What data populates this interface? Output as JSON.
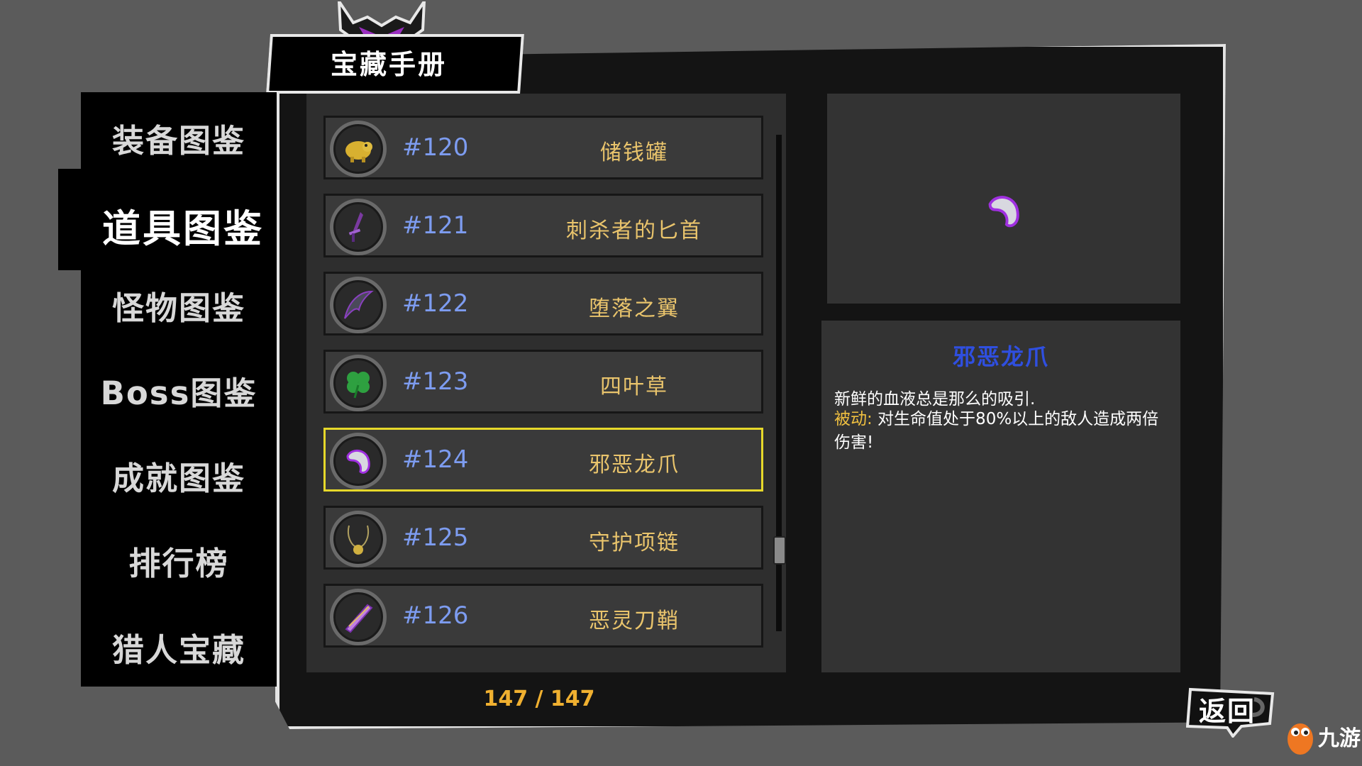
{
  "title": "宝藏手册",
  "menu": {
    "items": [
      {
        "label": "装备图鉴"
      },
      {
        "label": "道具图鉴"
      },
      {
        "label": "怪物图鉴"
      },
      {
        "label": "Boss图鉴"
      },
      {
        "label": "成就图鉴"
      },
      {
        "label": "排行榜"
      },
      {
        "label": "猎人宝藏"
      }
    ],
    "active_index": 1
  },
  "items": [
    {
      "number": "#120",
      "name": "储钱罐",
      "icon": "piggy-bank-icon"
    },
    {
      "number": "#121",
      "name": "刺杀者的匕首",
      "icon": "dagger-icon"
    },
    {
      "number": "#122",
      "name": "堕落之翼",
      "icon": "fallen-wing-icon"
    },
    {
      "number": "#123",
      "name": "四叶草",
      "icon": "four-leaf-clover-icon"
    },
    {
      "number": "#124",
      "name": "邪恶龙爪",
      "icon": "dragon-claw-icon",
      "selected": true
    },
    {
      "number": "#125",
      "name": "守护项链",
      "icon": "necklace-icon"
    },
    {
      "number": "#126",
      "name": "恶灵刀鞘",
      "icon": "scabbard-icon"
    }
  ],
  "count": "147 / 147",
  "detail": {
    "name": "邪恶龙爪",
    "flavor": "新鲜的血液总是那么的吸引.",
    "effect_label": "被动:",
    "effect_text": " 对生命值处于80%以上的敌人造成两倍伤害!",
    "icon": "dragon-claw-icon"
  },
  "back_label": "返回",
  "watermark": "九游",
  "colors": {
    "number": "#7d9cf0",
    "item_name": "#e9c46c",
    "selected_border": "#e6d82a",
    "detail_title": "#2f4fe0",
    "effect_label": "#f0c040",
    "count": "#f0b030"
  }
}
